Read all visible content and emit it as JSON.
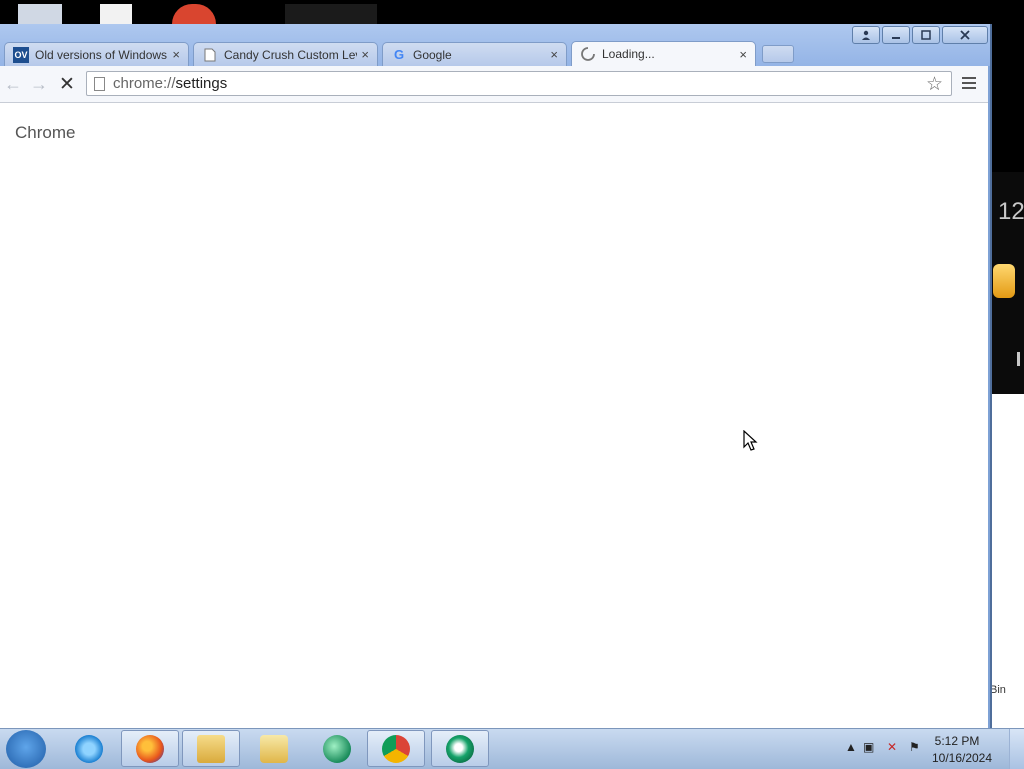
{
  "colors": {
    "window_frame": "#7ea1d5",
    "tab_inactive": "#c3d4f0",
    "tab_active": "#f5f7fb",
    "toolbar": "#f5f7fb",
    "content_bg": "#ffffff",
    "taskbar": "#b7cbe6"
  },
  "desktop": {
    "right_edge_number": "12",
    "right_edge_text": "Bin"
  },
  "window": {
    "controls": [
      "profile-icon",
      "minimize-icon",
      "maximize-icon",
      "close-icon"
    ],
    "tabs": [
      {
        "favicon": "OV",
        "favicon_name": "oldversion-icon",
        "title": "Old versions of Windows",
        "active": false
      },
      {
        "favicon": "",
        "favicon_name": "document-icon",
        "title": "Candy Crush Custom Leve",
        "active": false
      },
      {
        "favicon": "G",
        "favicon_name": "google-icon",
        "title": "Google",
        "active": false
      },
      {
        "favicon": "",
        "favicon_name": "loading-spinner-icon",
        "title": "Loading...",
        "active": true
      }
    ],
    "close_glyph": "×"
  },
  "toolbar": {
    "back_glyph": "←",
    "forward_glyph": "→",
    "stop_glyph": "✕",
    "url_scheme": "chrome://",
    "url_path": "settings",
    "star_glyph": "☆"
  },
  "content": {
    "heading": "Chrome"
  },
  "taskbar": {
    "apps": [
      {
        "name": "internet-explorer-icon",
        "running": false
      },
      {
        "name": "firefox-icon",
        "running": true
      },
      {
        "name": "file-explorer-icon",
        "running": true
      },
      {
        "name": "media-player-icon",
        "running": false
      },
      {
        "name": "green-app-icon",
        "running": false
      },
      {
        "name": "chrome-icon",
        "running": true
      },
      {
        "name": "green-swirl-app-icon",
        "running": true
      }
    ],
    "tray": {
      "time": "5:12 PM",
      "date": "10/16/2024"
    }
  }
}
